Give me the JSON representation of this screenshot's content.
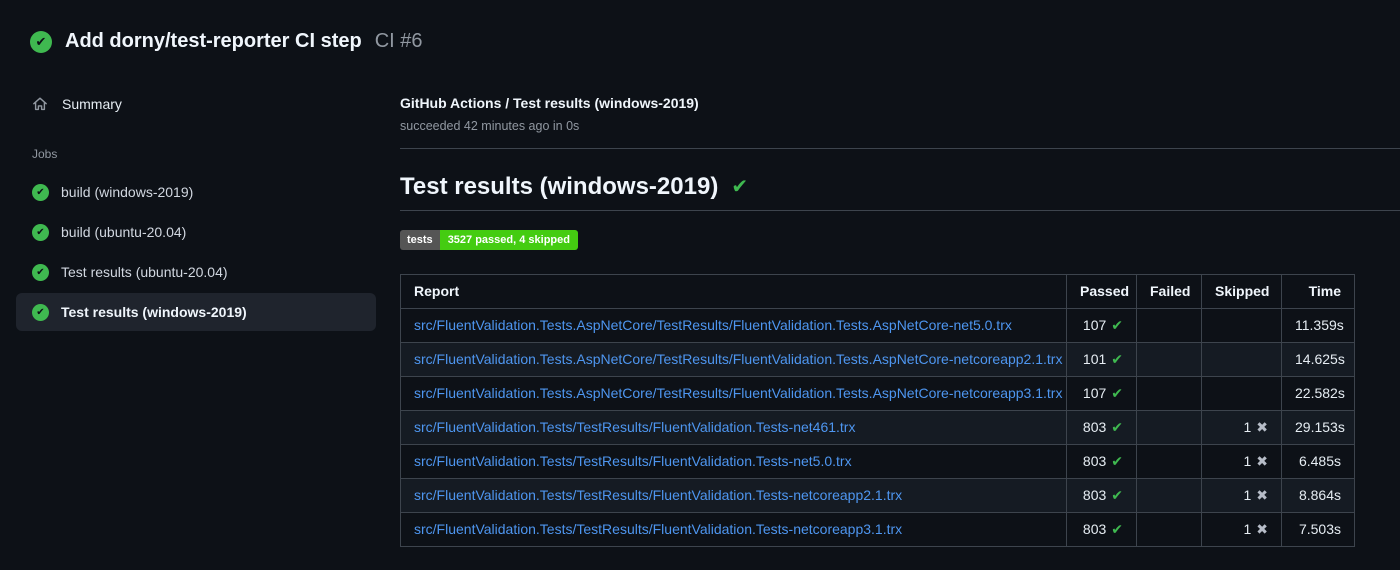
{
  "icons": {
    "check": "✔",
    "cross": "✖"
  },
  "colors": {
    "background": "#0d1117",
    "success_green": "#3fb950",
    "border": "#3d444d",
    "link_blue": "#4e96f0",
    "badge_label_bg": "#555555",
    "badge_value_bg": "#44cc11"
  },
  "run_header": {
    "title": "Add dorny/test-reporter CI step",
    "run_number": "CI #6",
    "status": "success"
  },
  "sidebar": {
    "summary_label": "Summary",
    "jobs_label": "Jobs",
    "jobs": [
      {
        "label": "build (windows-2019)",
        "status": "success",
        "selected": false
      },
      {
        "label": "build (ubuntu-20.04)",
        "status": "success",
        "selected": false
      },
      {
        "label": "Test results (ubuntu-20.04)",
        "status": "success",
        "selected": false
      },
      {
        "label": "Test results (windows-2019)",
        "status": "success",
        "selected": true
      }
    ]
  },
  "main": {
    "checkrun": {
      "title": "GitHub Actions / Test results (windows-2019)",
      "status_line": "succeeded 42 minutes ago in 0s"
    },
    "section_heading": "Test results (windows-2019)",
    "badge": {
      "label": "tests",
      "value": "3527 passed, 4 skipped"
    },
    "table": {
      "columns": [
        "Report",
        "Passed",
        "Failed",
        "Skipped",
        "Time"
      ],
      "rows": [
        {
          "report": "src/FluentValidation.Tests.AspNetCore/TestResults/FluentValidation.Tests.AspNetCore-net5.0.trx",
          "passed": "107",
          "failed": "",
          "skipped": "",
          "time": "11.359s"
        },
        {
          "report": "src/FluentValidation.Tests.AspNetCore/TestResults/FluentValidation.Tests.AspNetCore-netcoreapp2.1.trx",
          "passed": "101",
          "failed": "",
          "skipped": "",
          "time": "14.625s"
        },
        {
          "report": "src/FluentValidation.Tests.AspNetCore/TestResults/FluentValidation.Tests.AspNetCore-netcoreapp3.1.trx",
          "passed": "107",
          "failed": "",
          "skipped": "",
          "time": "22.582s"
        },
        {
          "report": "src/FluentValidation.Tests/TestResults/FluentValidation.Tests-net461.trx",
          "passed": "803",
          "failed": "",
          "skipped": "1",
          "time": "29.153s"
        },
        {
          "report": "src/FluentValidation.Tests/TestResults/FluentValidation.Tests-net5.0.trx",
          "passed": "803",
          "failed": "",
          "skipped": "1",
          "time": "6.485s"
        },
        {
          "report": "src/FluentValidation.Tests/TestResults/FluentValidation.Tests-netcoreapp2.1.trx",
          "passed": "803",
          "failed": "",
          "skipped": "1",
          "time": "8.864s"
        },
        {
          "report": "src/FluentValidation.Tests/TestResults/FluentValidation.Tests-netcoreapp3.1.trx",
          "passed": "803",
          "failed": "",
          "skipped": "1",
          "time": "7.503s"
        }
      ]
    }
  }
}
